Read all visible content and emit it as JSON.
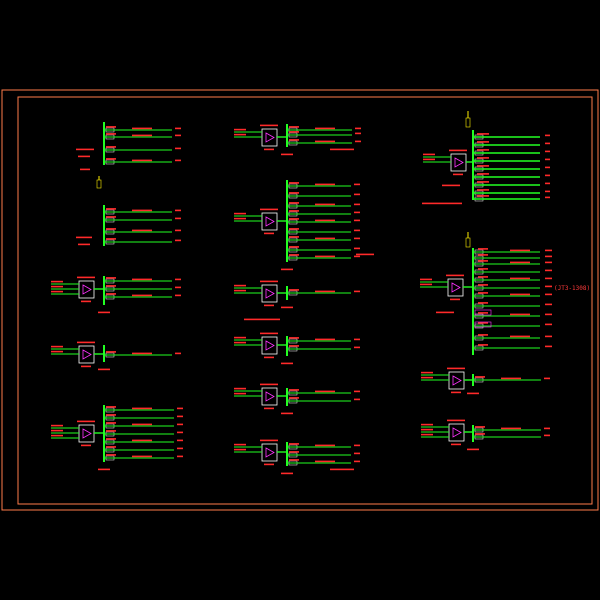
{
  "colors": {
    "background": "#000000",
    "border": "#ff7b4a",
    "line": "#22ff22",
    "label": "#ff2a2a",
    "device_box": "#ffffff",
    "device_symbol": "#ff33ff",
    "highlight": "#ffee00"
  },
  "annotation_note": "(JT3-1308)"
}
